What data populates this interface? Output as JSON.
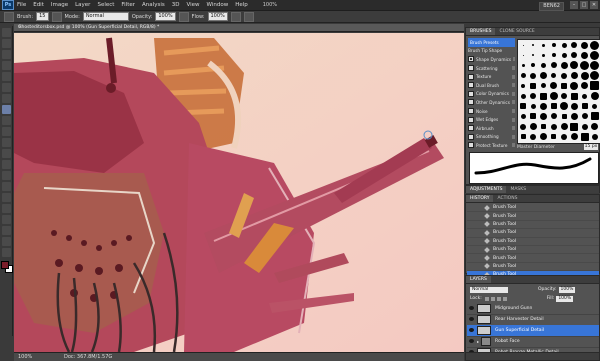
{
  "app": {
    "logo": "Ps",
    "menus": [
      "File",
      "Edit",
      "Image",
      "Layer",
      "Select",
      "Filter",
      "Analysis",
      "3D",
      "View",
      "Window",
      "Help"
    ],
    "zoom": "100%",
    "workspace": "BEN62",
    "window_controls": [
      "–",
      "□",
      "✕"
    ]
  },
  "options_bar": {
    "brush_label": "Brush:",
    "brush_size": "15",
    "mode_label": "Mode:",
    "mode_value": "Normal",
    "opacity_label": "Opacity:",
    "opacity_value": "100%",
    "flow_label": "Flow:",
    "flow_value": "100%"
  },
  "document": {
    "tab_title": "Ghosteditorsbox.psd @ 100% (Gun Superficial Detail, RGB/8) *",
    "status_zoom": "100%",
    "status_doc": "Doc: 367.8M/1.57G"
  },
  "brushes_panel": {
    "tabs": [
      "BRUSHES",
      "CLONE SOURCE"
    ],
    "list": [
      {
        "label": "Brush Presets",
        "header": true
      },
      {
        "label": "Brush Tip Shape",
        "header": false,
        "checkbox": false
      },
      {
        "label": "Shape Dynamics",
        "header": false,
        "checkbox": true,
        "checked": true
      },
      {
        "label": "Scattering",
        "header": false,
        "checkbox": true,
        "checked": false
      },
      {
        "label": "Texture",
        "header": false,
        "checkbox": true,
        "checked": false
      },
      {
        "label": "Dual Brush",
        "header": false,
        "checkbox": true,
        "checked": false
      },
      {
        "label": "Color Dynamics",
        "header": false,
        "checkbox": true,
        "checked": false
      },
      {
        "label": "Other Dynamics",
        "header": false,
        "checkbox": true,
        "checked": false
      },
      {
        "label": "Noise",
        "header": false,
        "checkbox": true,
        "checked": false
      },
      {
        "label": "Wet Edges",
        "header": false,
        "checkbox": true,
        "checked": false
      },
      {
        "label": "Airbrush",
        "header": false,
        "checkbox": true,
        "checked": false
      },
      {
        "label": "Smoothing",
        "header": false,
        "checkbox": true,
        "checked": false
      },
      {
        "label": "Protect Texture",
        "header": false,
        "checkbox": true,
        "checked": false
      }
    ],
    "master_diameter_label": "Master Diameter",
    "master_diameter_value": "15 px"
  },
  "adjustments_tabs": [
    "ADJUSTMENTS",
    "MASKS"
  ],
  "history_panel": {
    "tabs": [
      "HISTORY",
      "ACTIONS"
    ],
    "items": [
      "Brush Tool",
      "Brush Tool",
      "Brush Tool",
      "Brush Tool",
      "Brush Tool",
      "Brush Tool",
      "Brush Tool",
      "Brush Tool",
      "Brush Tool"
    ],
    "selected_index": 8
  },
  "layers_panel": {
    "tabs": [
      "LAYERS"
    ],
    "blend_mode": "Normal",
    "opacity_label": "Opacity:",
    "opacity_value": "100%",
    "lock_label": "Lock:",
    "fill_label": "Fill:",
    "fill_value": "100%",
    "layers": [
      {
        "name": "Midground Gunn",
        "selected": false,
        "group": false
      },
      {
        "name": "Rear Harvester Detail",
        "selected": false,
        "group": false
      },
      {
        "name": "Gun Superficial Detail",
        "selected": true,
        "group": false
      },
      {
        "name": "Robot Face",
        "selected": false,
        "group": true
      },
      {
        "name": "Robot Bronze Metallic Detail",
        "selected": false,
        "group": false
      }
    ]
  },
  "colors": {
    "accent": "#3875d7",
    "foreground_swatch": "#7a1e2a",
    "background_swatch": "#ffffff"
  }
}
